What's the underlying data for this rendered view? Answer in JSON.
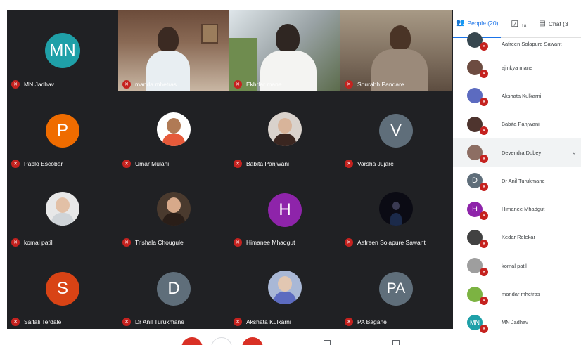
{
  "colors": {
    "grid_bg": "#202124",
    "mic_off": "#c5221f",
    "accent": "#1a73e8"
  },
  "tiles": [
    {
      "name": "MN Jadhav",
      "initials": "MN",
      "avatar_color": "#1fa0a8",
      "kind": "initials"
    },
    {
      "name": "manda mhetras",
      "kind": "video"
    },
    {
      "name": "Ekhdar mane",
      "kind": "video"
    },
    {
      "name": "Sourabh Pandare",
      "kind": "video"
    },
    {
      "name": "Pablo Escobar",
      "initials": "P",
      "avatar_color": "#ef6c00",
      "kind": "initials"
    },
    {
      "name": "Umar Mulani",
      "kind": "photo"
    },
    {
      "name": "Babita Panjwani",
      "kind": "photo"
    },
    {
      "name": "Varsha Jujare",
      "initials": "V",
      "avatar_color": "#5f6e7a",
      "kind": "initials"
    },
    {
      "name": "komal patil",
      "kind": "photo"
    },
    {
      "name": "Trishala Chougule",
      "kind": "photo"
    },
    {
      "name": "Himanee Mhadgut",
      "initials": "H",
      "avatar_color": "#8e24aa",
      "kind": "initials"
    },
    {
      "name": "Aafreen Solapure Sawant",
      "kind": "photo"
    },
    {
      "name": "Saifali Terdale",
      "initials": "S",
      "avatar_color": "#d84315",
      "kind": "initials"
    },
    {
      "name": "Dr Anil Turukmane",
      "initials": "D",
      "avatar_color": "#5f6e7a",
      "kind": "initials"
    },
    {
      "name": "Akshata Kulkarni",
      "kind": "photo"
    },
    {
      "name": "PA Bagane",
      "initials": "PA",
      "avatar_color": "#5f6e7a",
      "kind": "initials"
    }
  ],
  "sidebar": {
    "tabs": [
      {
        "label": "People (20)",
        "icon": "people-icon"
      },
      {
        "label": "18",
        "icon": "checklist-icon"
      },
      {
        "label": "Chat (3",
        "icon": "chat-icon"
      }
    ],
    "people": [
      {
        "name": "Aafreen Solapure Sawant",
        "initials": "",
        "color": "#37474f"
      },
      {
        "name": "ajinkya mane",
        "initials": "",
        "color": "#6d4c41"
      },
      {
        "name": "Akshata Kulkarni",
        "initials": "",
        "color": "#5c6bc0"
      },
      {
        "name": "Babita Panjwani",
        "initials": "",
        "color": "#4e342e"
      },
      {
        "name": "Devendra Dubey",
        "initials": "",
        "color": "#8d6e63"
      },
      {
        "name": "Dr Anil Turukmane",
        "initials": "D",
        "color": "#5f6e7a"
      },
      {
        "name": "Himanee Mhadgut",
        "initials": "H",
        "color": "#8e24aa"
      },
      {
        "name": "Kedar Relekar",
        "initials": "",
        "color": "#424242"
      },
      {
        "name": "komal patil",
        "initials": "",
        "color": "#9e9e9e"
      },
      {
        "name": "mandar mhetras",
        "initials": "",
        "color": "#7cb342"
      },
      {
        "name": "MN Jadhav",
        "initials": "MN",
        "color": "#1fa0a8"
      }
    ]
  }
}
